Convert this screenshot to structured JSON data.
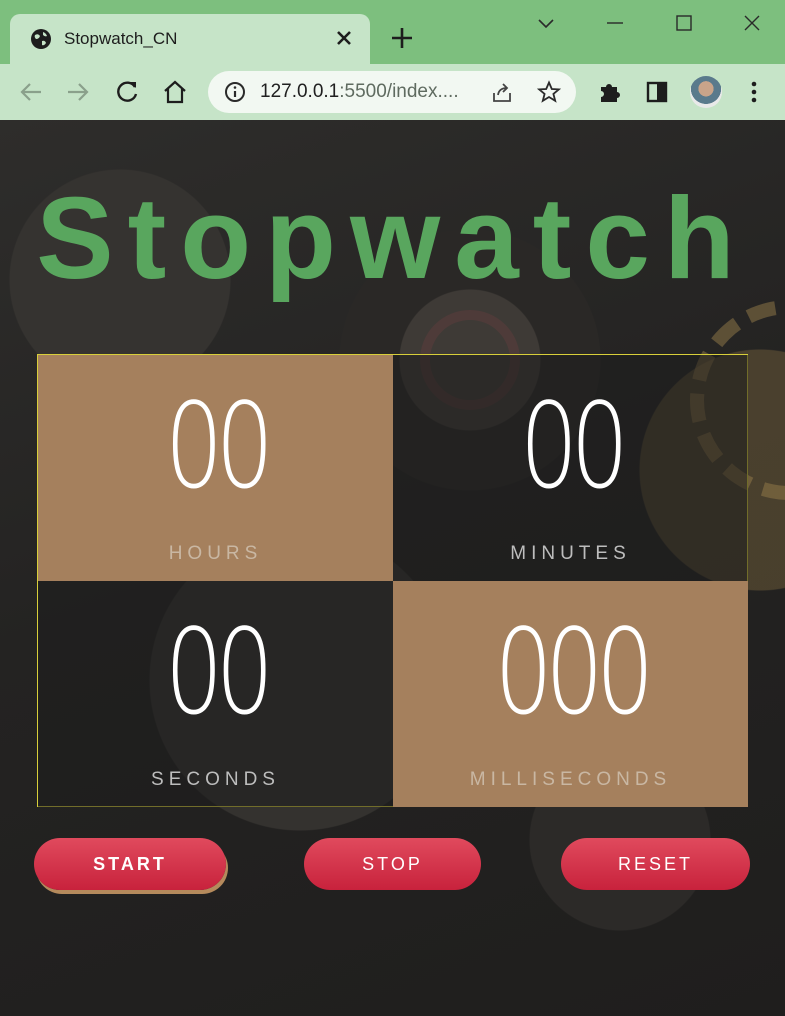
{
  "browser": {
    "tab_title": "Stopwatch_CN",
    "url_host": "127.0.0.1",
    "url_rest": ":5500/index....",
    "icons": [
      "globe-icon",
      "close-icon",
      "plus-icon",
      "chevron-down-icon",
      "minimize-icon",
      "maximize-icon",
      "window-close-icon",
      "back-icon",
      "forward-icon",
      "reload-icon",
      "home-icon",
      "info-icon",
      "share-icon",
      "star-icon",
      "extensions-icon",
      "sidepanel-icon",
      "menu-icon"
    ]
  },
  "page": {
    "heading": "Stopwatch",
    "heading_color": "#59a65e",
    "tan_color": "#a5805d",
    "button_color": "#d33049",
    "timer": {
      "hours": {
        "value": "00",
        "label": "HOURS"
      },
      "minutes": {
        "value": "00",
        "label": "MINUTES"
      },
      "seconds": {
        "value": "00",
        "label": "SECONDS"
      },
      "milliseconds": {
        "value": "000",
        "label": "MILLISECONDS"
      }
    },
    "buttons": {
      "start": "START",
      "stop": "STOP",
      "reset": "RESET"
    }
  }
}
